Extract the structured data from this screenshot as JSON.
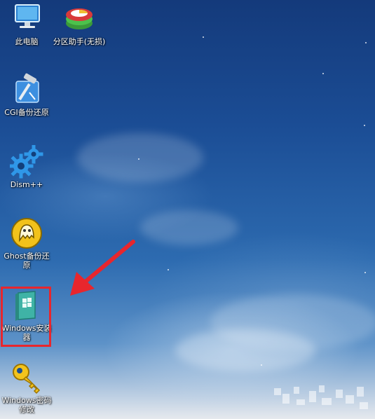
{
  "desktop": {
    "icons": [
      {
        "label": "此电脑",
        "icon": "computer-icon"
      },
      {
        "label": "分区助手(无损)",
        "icon": "partition-assistant-icon"
      },
      {
        "label": "CGI备份还原",
        "icon": "cgi-backup-icon"
      },
      {
        "label": "Dism++",
        "icon": "gears-icon"
      },
      {
        "label": "Ghost备份还原",
        "icon": "ghost-icon"
      },
      {
        "label": "Windows安装器",
        "icon": "windows-installer-icon"
      },
      {
        "label": "Windows密码修改",
        "icon": "key-icon"
      }
    ],
    "selected_icon": "Windows安装器",
    "highlight_color": "#e8262d"
  }
}
